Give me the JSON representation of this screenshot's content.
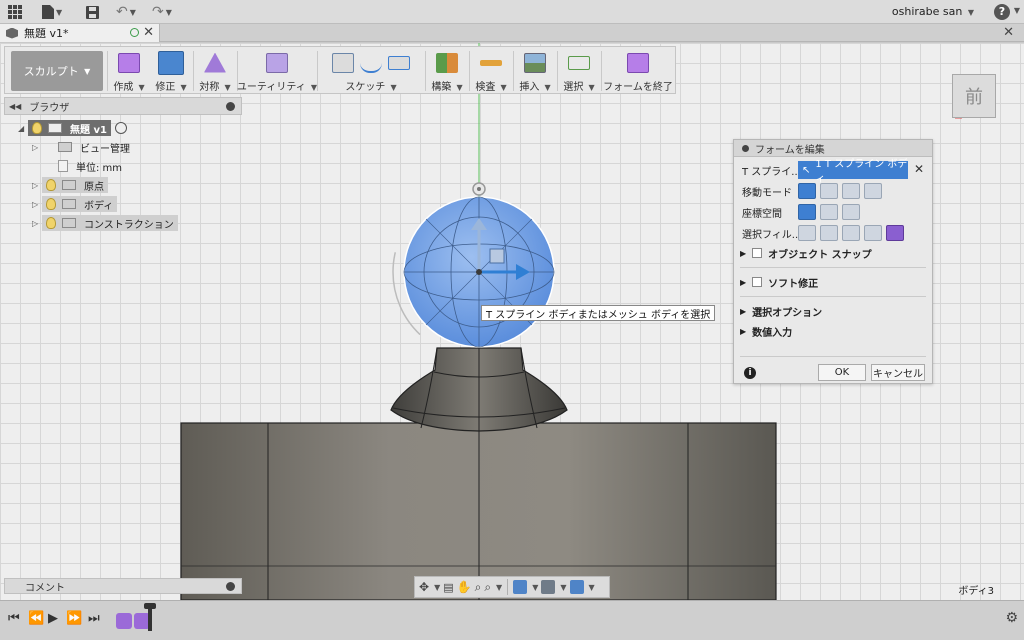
{
  "topbar": {
    "user": "oshirabe san",
    "help": "?"
  },
  "tab": {
    "title": "無題 v1*"
  },
  "toolbar": {
    "workspace": "スカルプト",
    "groups": [
      {
        "label": "作成"
      },
      {
        "label": "修正"
      },
      {
        "label": "対称"
      },
      {
        "label": "ユーティリティ"
      },
      {
        "label": "スケッチ"
      },
      {
        "label": "構築"
      },
      {
        "label": "検査"
      },
      {
        "label": "挿入"
      },
      {
        "label": "選択"
      },
      {
        "label": "フォームを終了"
      }
    ]
  },
  "browser": {
    "title": "ブラウザ",
    "items": [
      {
        "label": "無題 v1"
      },
      {
        "label": "ビュー管理"
      },
      {
        "label": "単位: mm"
      },
      {
        "label": "原点"
      },
      {
        "label": "ボディ"
      },
      {
        "label": "コンストラクション"
      }
    ]
  },
  "comment": {
    "label": "コメント"
  },
  "viewcube": {
    "face": "前"
  },
  "status": {
    "body": "ボディ3"
  },
  "dialog": {
    "title": "フォームを編集",
    "rows": {
      "tspline_label": "T スプライ...",
      "tspline_value": "1 T スプライン ボディ",
      "move_mode": "移動モード",
      "coord_space": "座標空間",
      "select_filter": "選択フィル..."
    },
    "sections": {
      "object_snap": "オブジェクト スナップ",
      "soft_modify": "ソフト修正",
      "select_options": "選択オプション",
      "numeric_input": "数値入力"
    },
    "buttons": {
      "ok": "OK",
      "cancel": "キャンセル"
    }
  },
  "tooltip": {
    "text": "T スプライン ボディまたはメッシュ ボディを選択"
  },
  "colors": {
    "accent": "#3e7fd1",
    "sphere": "#6d9ee6",
    "workspace": "#9a9a9a"
  }
}
